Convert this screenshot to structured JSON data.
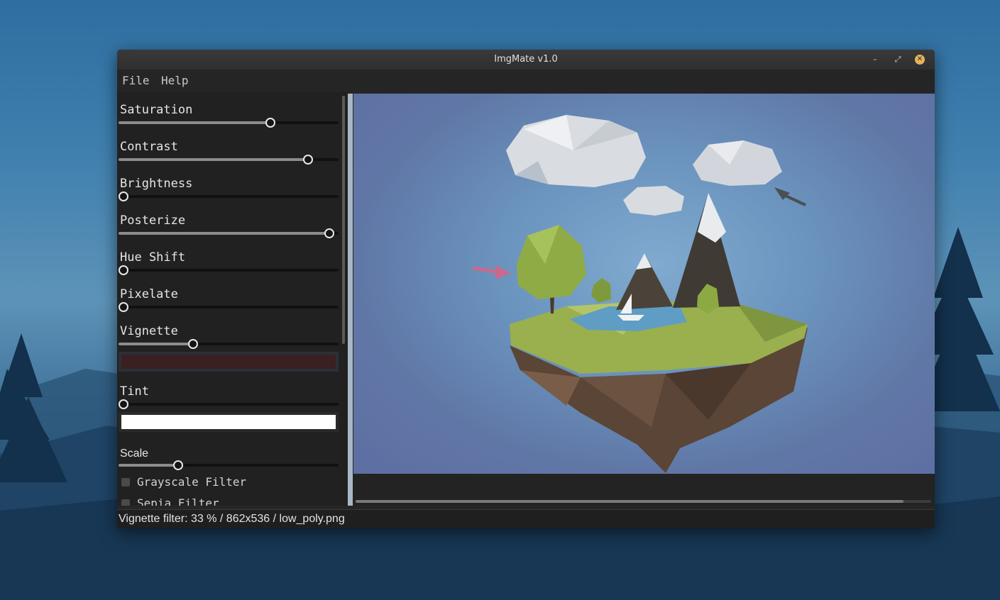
{
  "window": {
    "title": "ImgMate v1.0",
    "minimize_glyph": "–",
    "maximize_glyph": "⤢",
    "close_glyph": "✕"
  },
  "menu": {
    "items": [
      {
        "label": "File"
      },
      {
        "label": "Help"
      }
    ]
  },
  "sliders": [
    {
      "label": "Saturation",
      "value": 0.7
    },
    {
      "label": "Contrast",
      "value": 0.88
    },
    {
      "label": "Brightness",
      "value": 0.0
    },
    {
      "label": "Posterize",
      "value": 0.98
    },
    {
      "label": "Hue Shift",
      "value": 0.0
    },
    {
      "label": "Pixelate",
      "value": 0.0
    },
    {
      "label": "Vignette",
      "value": 0.33
    }
  ],
  "vignette_color": "#3a2022",
  "tint": {
    "label": "Tint",
    "value": 0.0,
    "color": "#ffffff"
  },
  "scale": {
    "label": "Scale",
    "value": 0.26
  },
  "filters": [
    {
      "label": "Grayscale Filter",
      "checked": false
    },
    {
      "label": "Sepia Filter",
      "checked": false
    }
  ],
  "status": {
    "text": "Vignette filter: 33 % / 862x536 / low_poly.png"
  },
  "colors": {
    "accent_close": "#e7b35c",
    "canvas_bg": "#6b95bf"
  }
}
